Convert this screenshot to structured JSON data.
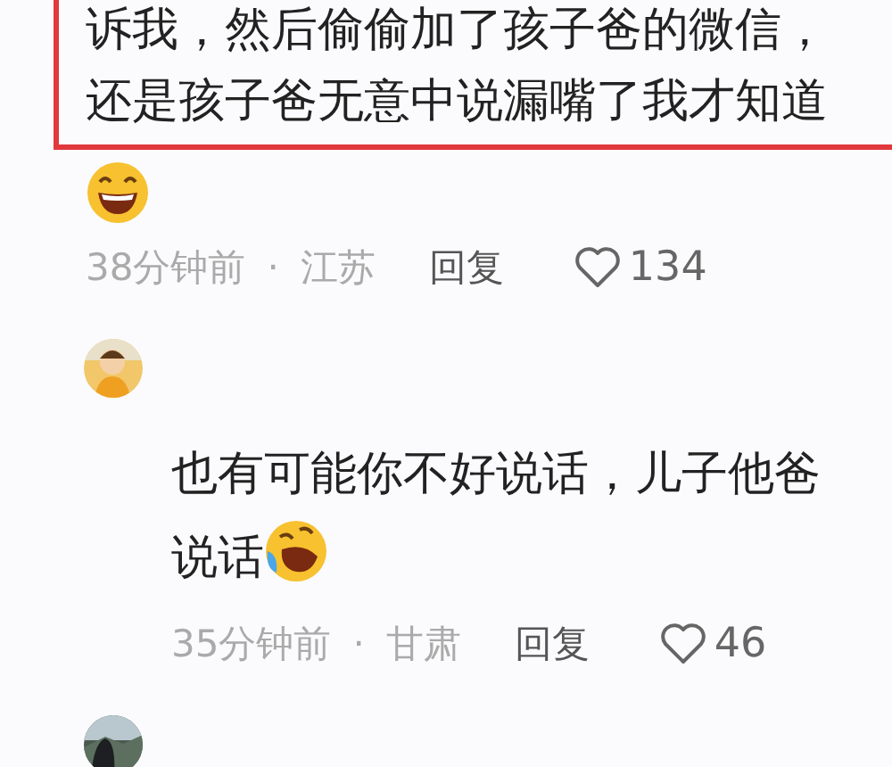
{
  "comments": [
    {
      "kind": "quoted",
      "lines": [
        "诉我，然后偷偷加了孩子爸的微信，",
        "还是孩子爸无意中说漏嘴了我才知道"
      ],
      "time": "38分钟前",
      "separator": "·",
      "location": "江苏",
      "reply": "回复",
      "likes": "134"
    },
    {
      "kind": "reply",
      "lines": [
        "也有可能你不好说话，儿子他爸",
        "说话"
      ],
      "time": "35分钟前",
      "separator": "·",
      "location": "甘肃",
      "reply": "回复",
      "likes": "46"
    },
    {
      "kind": "reply"
    }
  ]
}
